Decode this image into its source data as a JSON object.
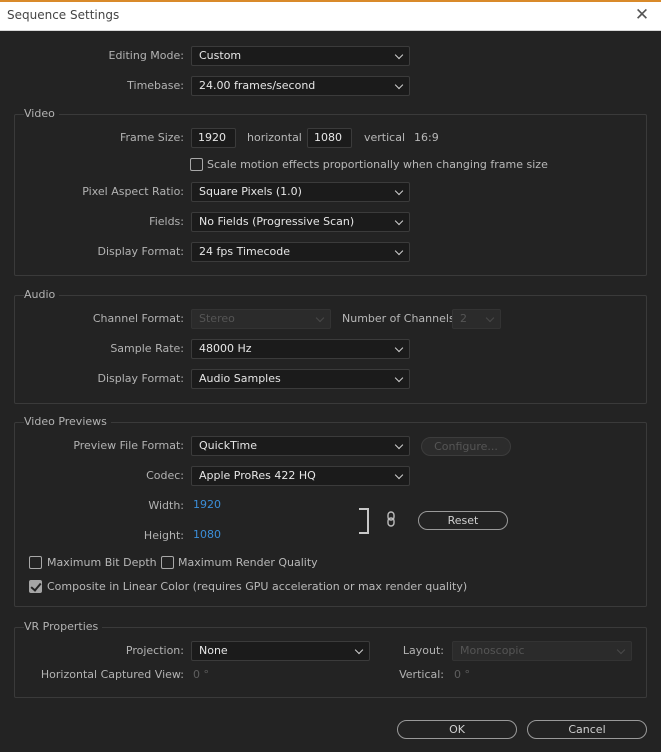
{
  "window": {
    "title": "Sequence Settings"
  },
  "general": {
    "editing_mode_label": "Editing Mode:",
    "editing_mode_value": "Custom",
    "timebase_label": "Timebase:",
    "timebase_value": "24.00  frames/second"
  },
  "video": {
    "section_title": "Video",
    "frame_size_label": "Frame Size:",
    "frame_width": "1920",
    "horizontal_label": "horizontal",
    "frame_height": "1080",
    "vertical_label": "vertical",
    "aspect_ratio": "16:9",
    "scale_motion_label": "Scale motion effects proportionally when changing frame size",
    "scale_motion_checked": false,
    "pixel_aspect_label": "Pixel Aspect Ratio:",
    "pixel_aspect_value": "Square Pixels (1.0)",
    "fields_label": "Fields:",
    "fields_value": "No Fields (Progressive Scan)",
    "display_format_label": "Display Format:",
    "display_format_value": "24 fps Timecode"
  },
  "audio": {
    "section_title": "Audio",
    "channel_format_label": "Channel Format:",
    "channel_format_value": "Stereo",
    "num_channels_label": "Number of Channels:",
    "num_channels_value": "2",
    "sample_rate_label": "Sample Rate:",
    "sample_rate_value": "48000 Hz",
    "display_format_label": "Display Format:",
    "display_format_value": "Audio Samples"
  },
  "previews": {
    "section_title": "Video Previews",
    "file_format_label": "Preview File Format:",
    "file_format_value": "QuickTime",
    "configure_label": "Configure...",
    "codec_label": "Codec:",
    "codec_value": "Apple ProRes 422 HQ",
    "width_label": "Width:",
    "width_value": "1920",
    "height_label": "Height:",
    "height_value": "1080",
    "reset_label": "Reset",
    "max_bit_depth_label": "Maximum Bit Depth",
    "max_bit_depth_checked": false,
    "max_render_quality_label": "Maximum Render Quality",
    "max_render_quality_checked": false,
    "composite_linear_label": "Composite in Linear Color (requires GPU acceleration or max render quality)",
    "composite_linear_checked": true
  },
  "vr": {
    "section_title": "VR Properties",
    "projection_label": "Projection:",
    "projection_value": "None",
    "layout_label": "Layout:",
    "layout_value": "Monoscopic",
    "h_captured_label": "Horizontal Captured View:",
    "h_captured_value": "0 °",
    "vertical_label": "Vertical:",
    "vertical_value": "0 °"
  },
  "footer": {
    "ok_label": "OK",
    "cancel_label": "Cancel"
  },
  "icons": {
    "close": "close-icon",
    "link": "link-icon",
    "chevron": "chevron-down-icon",
    "check": "check-icon"
  },
  "colors": {
    "accent": "#d98a2a",
    "value_blue": "#3b8ed8",
    "background": "#232323"
  }
}
